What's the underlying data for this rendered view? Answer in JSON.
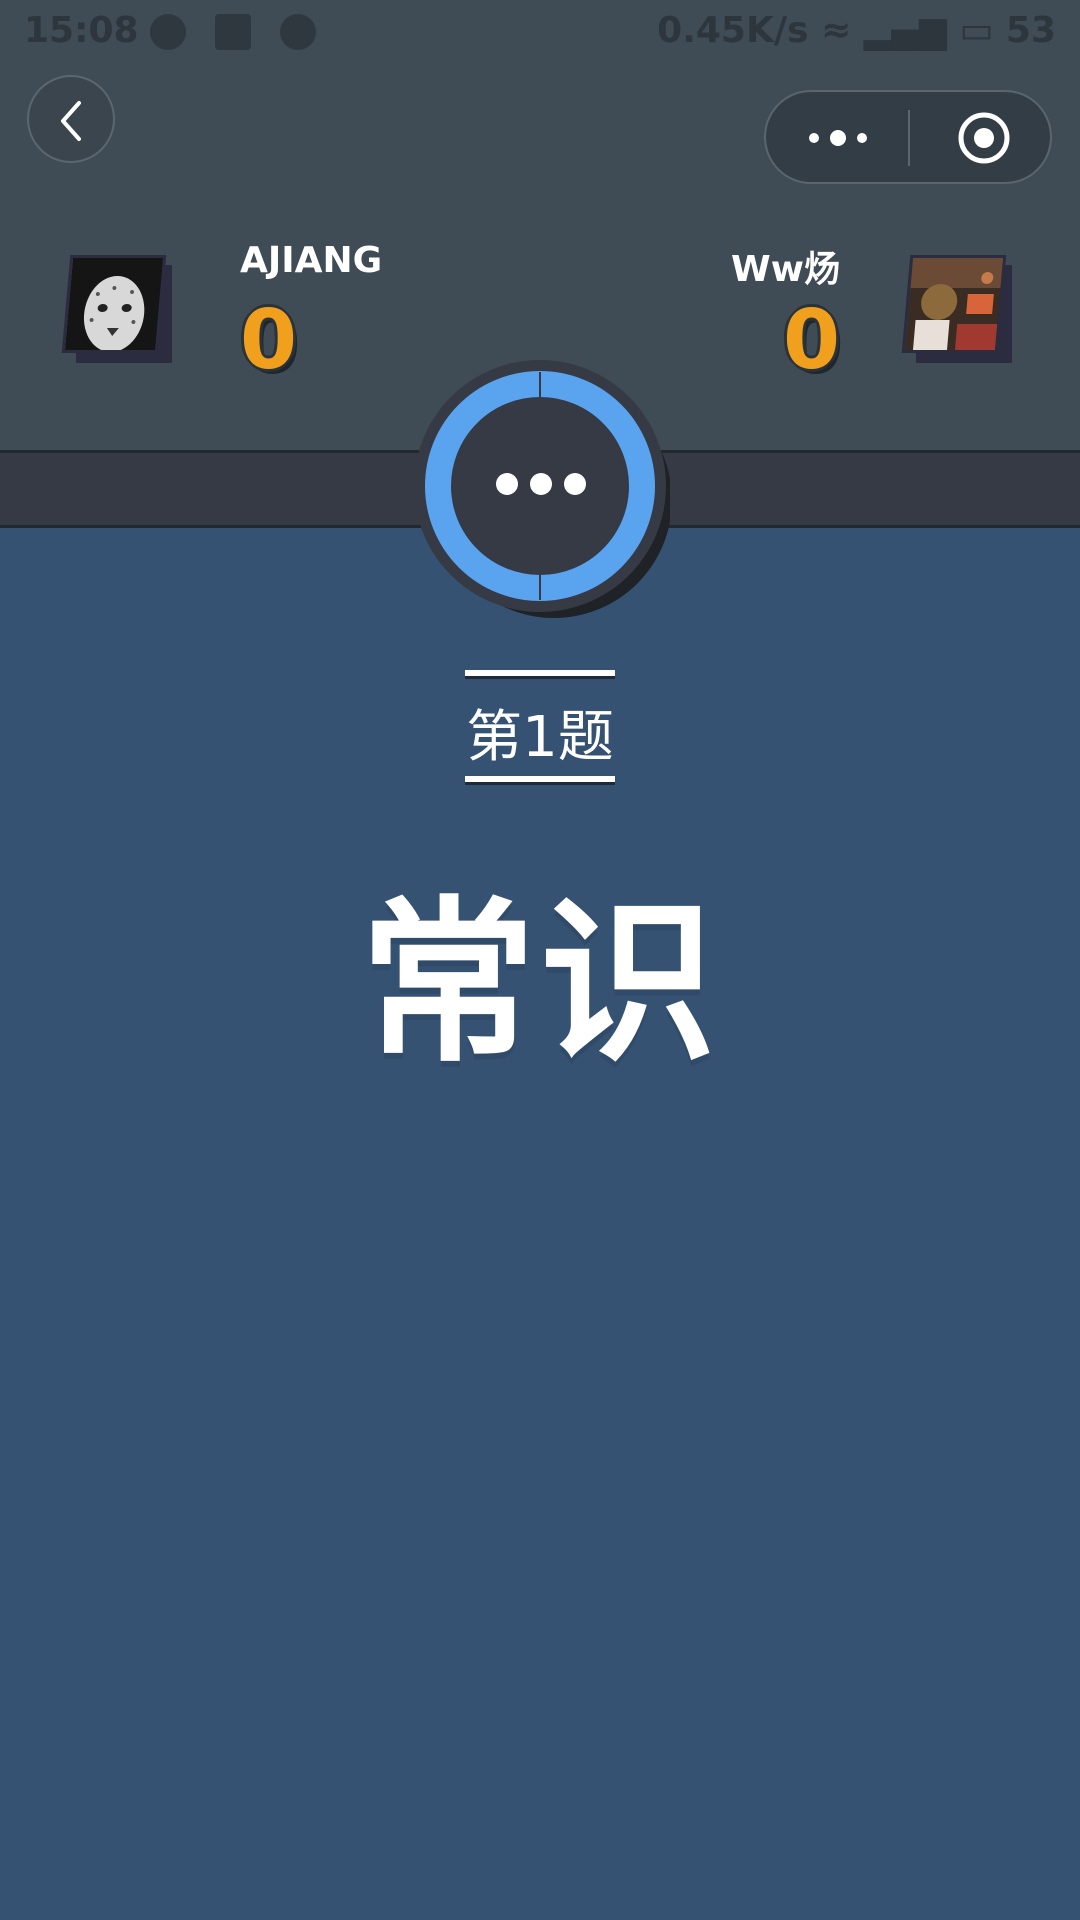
{
  "status_bar": {
    "time": "15:08",
    "right_text": "0.45K/s",
    "battery": "53",
    "icons": [
      "chat-icon",
      "image-icon",
      "record-icon",
      "alarm-icon",
      "clock-icon",
      "wifi-icon",
      "signal-icon",
      "battery-icon"
    ]
  },
  "nav": {
    "back_icon": "chevron-left-icon",
    "capsule_menu_icon": "more-dots-icon",
    "capsule_close_icon": "target-circle-icon"
  },
  "players": {
    "left": {
      "name": "AJIANG",
      "score": "0",
      "avatar": "cheetah-photo"
    },
    "right": {
      "name": "Ww炀",
      "score": "0",
      "avatar": "market-photo"
    }
  },
  "timer": {
    "state": "waiting",
    "ring_color": "#5aa3ee",
    "progress_fraction": 1.0
  },
  "question": {
    "round_label": "第1题",
    "category": "常识"
  },
  "colors": {
    "background": "#355273",
    "header": "#3f4b55",
    "band": "#353a45",
    "score": "#f0a01c"
  }
}
